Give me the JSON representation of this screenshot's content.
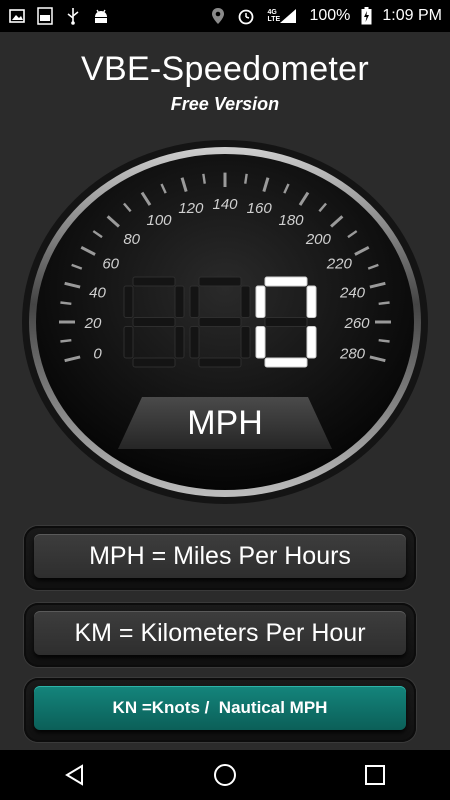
{
  "status_bar": {
    "battery_percent": "100%",
    "time": "1:09 PM",
    "network": "4G LTE",
    "icons_left": [
      "image-icon",
      "notification-100-icon",
      "usb-icon",
      "android-debug-icon"
    ],
    "icons_right": [
      "location-icon",
      "alarm-icon",
      "signal-icon",
      "battery-icon"
    ]
  },
  "app": {
    "title": "VBE-Speedometer",
    "subtitle": "Free Version"
  },
  "gauge": {
    "speed_value": "0",
    "unit_label": "MPH",
    "tick_labels": [
      "0",
      "20",
      "40",
      "60",
      "80",
      "100",
      "120",
      "140",
      "160",
      "180",
      "200",
      "220",
      "240",
      "260",
      "280"
    ]
  },
  "buttons": {
    "mph": "MPH = Miles Per Hours",
    "km": "KM = Kilometers Per Hour",
    "kn": "KN =Knots /  Nautical MPH"
  },
  "colors": {
    "background": "#2b2b2b",
    "teal_button": "#0f7169",
    "digit_lit": "#ffffff",
    "digit_unlit": "#141414"
  }
}
